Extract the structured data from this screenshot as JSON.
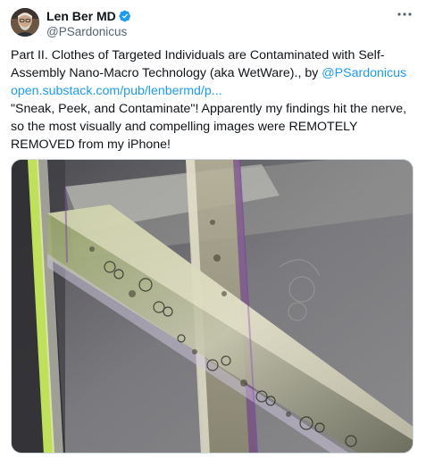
{
  "author": {
    "display_name": "Len Ber MD",
    "handle": "@PSardonicus",
    "avatar_icon": "user-avatar-photo",
    "verified_icon": "verified-badge-icon",
    "verified_color": "#1d9bf0"
  },
  "menu": {
    "more_icon": "more-horizontal-icon"
  },
  "post": {
    "line1_text": "Part II. Clothes of Targeted Individuals are Contaminated with Self-Assembly Nano-Macro Technology (aka WetWare)., by ",
    "mention": "@PSardonicus",
    "url": "open.substack.com/pub/lenbermd/p...",
    "paragraph2": "\"Sneak, Peek, and Contaminate\"! Apparently my findings hit the nerve, so the most visually and compelling images were REMOTELY REMOVED from my iPhone!"
  },
  "media": {
    "kind": "microscope-photo",
    "description_icon": "attached-image"
  },
  "colors": {
    "text": "#0f1419",
    "secondary": "#536471",
    "link": "#1d9bf0",
    "border": "#cfd9de"
  }
}
